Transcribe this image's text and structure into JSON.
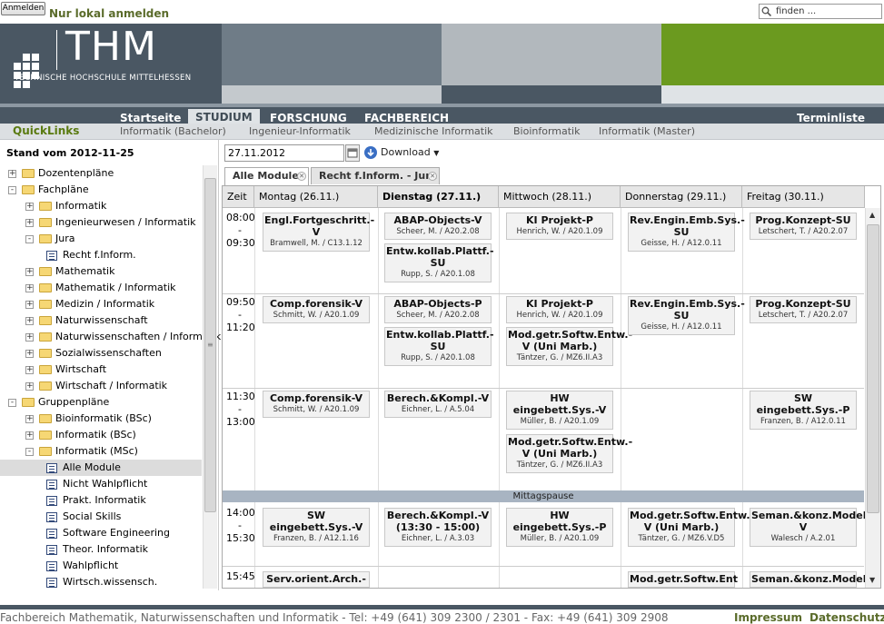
{
  "topbar": {
    "login_label": "Anmelden",
    "local_login": "Nur lokal anmelden",
    "search_placeholder": "finden ..."
  },
  "logo": {
    "big": "THM",
    "sub": "TECHNISCHE HOCHSCHULE MITTELHESSEN"
  },
  "nav": {
    "items": [
      "Startseite",
      "STUDIUM",
      "FORSCHUNG",
      "FACHBEREICH"
    ],
    "right": "Terminliste"
  },
  "quicklinks": {
    "title": "QuickLinks",
    "items": [
      "Informatik (Bachelor)",
      "Ingenieur-Informatik",
      "Medizinische Informatik",
      "Bioinformatik",
      "Informatik (Master)"
    ]
  },
  "sidebar": {
    "stand": "Stand vom 2012-11-25",
    "tree": [
      {
        "label": "Dozentenpläne",
        "pm": "+"
      },
      {
        "label": "Fachpläne",
        "pm": "-"
      },
      {
        "label": "Informatik",
        "pm": "+"
      },
      {
        "label": "Ingenieurwesen / Informatik",
        "pm": "+"
      },
      {
        "label": "Jura",
        "pm": "-"
      },
      {
        "label": "Recht f.Inform."
      },
      {
        "label": "Mathematik",
        "pm": "+"
      },
      {
        "label": "Mathematik / Informatik",
        "pm": "+"
      },
      {
        "label": "Medizin / Informatik",
        "pm": "+"
      },
      {
        "label": "Naturwissenschaft",
        "pm": "+"
      },
      {
        "label": "Naturwissenschaften / Informatik",
        "pm": "+"
      },
      {
        "label": "Sozialwissenschaften",
        "pm": "+"
      },
      {
        "label": "Wirtschaft",
        "pm": "+"
      },
      {
        "label": "Wirtschaft / Informatik",
        "pm": "+"
      },
      {
        "label": "Gruppenpläne",
        "pm": "-"
      },
      {
        "label": "Bioinformatik (BSc)",
        "pm": "+"
      },
      {
        "label": "Informatik (BSc)",
        "pm": "+"
      },
      {
        "label": "Informatik (MSc)",
        "pm": "-"
      },
      {
        "label": "Alle Module"
      },
      {
        "label": "Nicht Wahlpflicht"
      },
      {
        "label": "Prakt. Informatik"
      },
      {
        "label": "Social Skills"
      },
      {
        "label": "Software Engineering"
      },
      {
        "label": "Theor. Informatik"
      },
      {
        "label": "Wahlpflicht"
      },
      {
        "label": "Wirtsch.wissensch."
      }
    ]
  },
  "toolbar": {
    "date": "27.11.2012",
    "download": "Download"
  },
  "tabs": [
    "Alle Module",
    "Recht f.Inform. - Jura"
  ],
  "schedule": {
    "headers": [
      "Zeit",
      "Montag (26.11.)",
      "Dienstag (27.11.)",
      "Mittwoch (28.11.)",
      "Donnerstag (29.11.)",
      "Freitag (30.11.)"
    ],
    "times": [
      [
        "08:00",
        "-",
        "09:30"
      ],
      [
        "09:50",
        "-",
        "11:20"
      ],
      [
        "11:30",
        "-",
        "13:00"
      ],
      [
        "14:00",
        "-",
        "15:30"
      ],
      [
        "15:45"
      ]
    ],
    "pause": "Mittagspause",
    "events": {
      "e1": {
        "t": "Engl.Fortgeschritt.-V",
        "s": "Bramwell, M. / C13.1.12"
      },
      "e2": {
        "t": "ABAP-Objects-V",
        "s": "Scheer, M. / A20.2.08"
      },
      "e3": {
        "t": "Entw.kollab.Plattf.-SU",
        "s": "Rupp, S. / A20.1.08"
      },
      "e4": {
        "t": "KI Projekt-P",
        "s": "Henrich, W. / A20.1.09"
      },
      "e5": {
        "t": "Rev.Engin.Emb.Sys.-SU",
        "s": "Geisse, H. / A12.0.11"
      },
      "e6": {
        "t": "Prog.Konzept-SU",
        "s": "Letschert, T. / A20.2.07"
      },
      "e7": {
        "t": "Comp.forensik-V",
        "s": "Schmitt, W. / A20.1.09"
      },
      "e8": {
        "t": "ABAP-Objects-P",
        "s": "Scheer, M. / A20.2.08"
      },
      "e9": {
        "t": "Entw.kollab.Plattf.-SU",
        "s": "Rupp, S. / A20.1.08"
      },
      "e10": {
        "t": "KI Projekt-P",
        "s": "Henrich, W. / A20.1.09"
      },
      "e11": {
        "t": "Mod.getr.Softw.Entw.-V (Uni Marb.)",
        "s": "Täntzer, G. / MZ6.II.A3"
      },
      "e12": {
        "t": "Rev.Engin.Emb.Sys.-SU",
        "s": "Geisse, H. / A12.0.11"
      },
      "e13": {
        "t": "Prog.Konzept-SU",
        "s": "Letschert, T. / A20.2.07"
      },
      "e14": {
        "t": "Comp.forensik-V",
        "s": "Schmitt, W. / A20.1.09"
      },
      "e15": {
        "t": "Berech.&Kompl.-V",
        "s": "Eichner, L. / A.5.04"
      },
      "e16": {
        "t": "HW eingebett.Sys.-V",
        "s": "Müller, B. / A20.1.09"
      },
      "e17": {
        "t": "Mod.getr.Softw.Entw.-V (Uni Marb.)",
        "s": "Täntzer, G. / MZ6.II.A3"
      },
      "e18": {
        "t": "SW eingebett.Sys.-P",
        "s": "Franzen, B. / A12.0.11"
      },
      "e19": {
        "t": "SW eingebett.Sys.-V",
        "s": "Franzen, B. / A12.1.16"
      },
      "e20": {
        "t": "Berech.&Kompl.-V (13:30 - 15:00)",
        "s": "Eichner, L. / A.3.03"
      },
      "e21": {
        "t": "HW eingebett.Sys.-P",
        "s": "Müller, B. / A20.1.09"
      },
      "e22": {
        "t": "Mod.getr.Softw.Entw.-V (Uni Marb.)",
        "s": "Täntzer, G. / MZ6.V.D5"
      },
      "e23": {
        "t": "Seman.&konz.Model.-V",
        "s": "Walesch / A.2.01"
      },
      "e24": {
        "t": "Serv.orient.Arch.-"
      },
      "e25": {
        "t": "Mod.getr.Softw.Ent"
      },
      "e26": {
        "t": "Seman.&konz.Model"
      }
    }
  },
  "footer": {
    "text": "Fachbereich Mathematik, Naturwissenschaften und Informatik - Tel: +49 (641) 309 2300 / 2301 - Fax: +49 (641) 309 2908",
    "impressum": "Impressum",
    "datenschutz": "Datenschutz"
  },
  "colors": {
    "dark": "#4a5763",
    "green": "#6b9a1f",
    "accent_text": "#5a6b2a"
  }
}
